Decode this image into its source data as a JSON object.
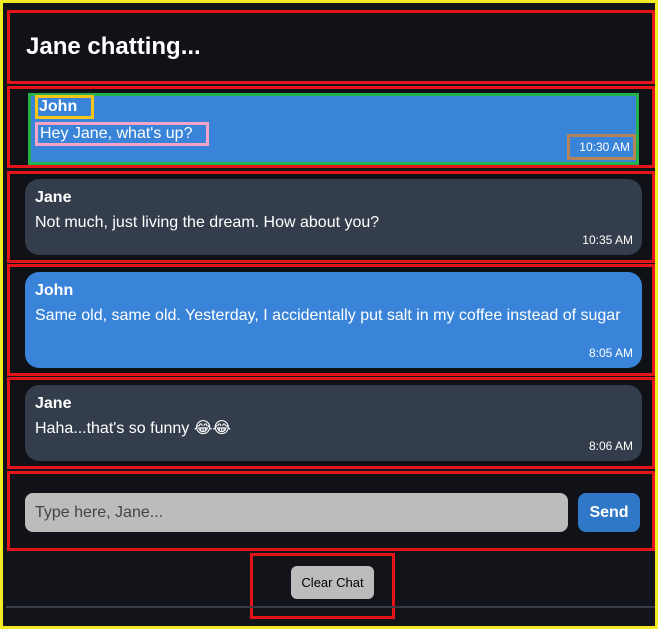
{
  "header": {
    "title": "Jane chatting..."
  },
  "messages": [
    {
      "sender": "John",
      "text": "Hey Jane, what's up?",
      "time": "10:30 AM",
      "style": "blue"
    },
    {
      "sender": "Jane",
      "text": "Not much, just living the dream. How about you?",
      "time": "10:35 AM",
      "style": "gray"
    },
    {
      "sender": "John",
      "text": "Same old, same old. Yesterday, I accidentally put salt in my coffee instead of sugar",
      "time": "8:05 AM",
      "style": "blue"
    },
    {
      "sender": "Jane",
      "text": "Haha...that's so funny 😂😂",
      "time": "8:06 AM",
      "style": "gray"
    }
  ],
  "composer": {
    "placeholder": "Type here, Jane...",
    "value": "",
    "send_label": "Send"
  },
  "actions": {
    "clear_label": "Clear Chat"
  },
  "colors": {
    "accent_blue": "#3984d9",
    "bubble_gray": "#343d4b",
    "background": "#13141a",
    "annotation_red": "#e5141b"
  }
}
